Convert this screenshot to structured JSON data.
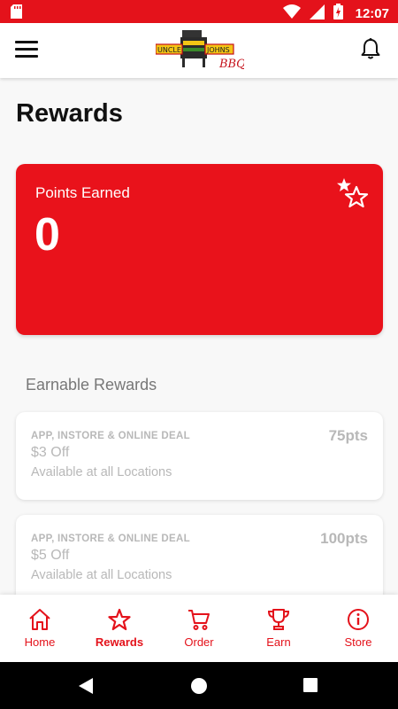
{
  "status_bar": {
    "time": "12:07",
    "color": "#e4121b"
  },
  "header": {
    "logo_text_1": "UNCLE",
    "logo_text_2": "JOHNS",
    "logo_script": "BBQ"
  },
  "page": {
    "title": "Rewards"
  },
  "points_card": {
    "label": "Points Earned",
    "value": "0",
    "icon": "stars-icon"
  },
  "earnable": {
    "title": "Earnable Rewards",
    "items": [
      {
        "tag": "APP, INSTORE & ONLINE DEAL",
        "name": "$3 Off",
        "availability": "Available at all Locations",
        "points": "75pts"
      },
      {
        "tag": "APP, INSTORE & ONLINE DEAL",
        "name": "$5 Off",
        "availability": "Available at all Locations",
        "points": "100pts"
      }
    ]
  },
  "nav": {
    "items": [
      {
        "label": "Home",
        "icon": "home-icon"
      },
      {
        "label": "Rewards",
        "icon": "star-icon",
        "active": true
      },
      {
        "label": "Order",
        "icon": "cart-icon"
      },
      {
        "label": "Earn",
        "icon": "trophy-icon"
      },
      {
        "label": "Store",
        "icon": "info-icon"
      }
    ]
  },
  "colors": {
    "accent": "#e4121b",
    "muted_text": "#b8b8b8"
  }
}
